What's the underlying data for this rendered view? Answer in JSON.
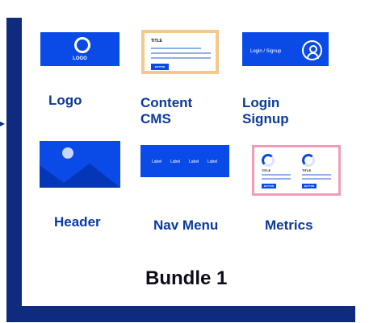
{
  "bundle": {
    "title": "Bundle 1"
  },
  "pointer": {
    "glyph": "▸"
  },
  "modules": {
    "logo": {
      "label": "Logo",
      "thumb_text": "LOGO"
    },
    "cms": {
      "label_line1": "Content",
      "label_line2": "CMS",
      "thumb_title": "TITLE",
      "thumb_button": "BUTTON"
    },
    "login": {
      "label_line1": "Login",
      "label_line2": "Signup",
      "thumb_text": "Login / Signup"
    },
    "header": {
      "label": "Header"
    },
    "nav": {
      "label": "Nav Menu",
      "items": [
        "Label",
        "Label",
        "Label",
        "Label"
      ]
    },
    "metrics": {
      "label": "Metrics",
      "cards": [
        {
          "title": "TITLE",
          "button": "BUTTON"
        },
        {
          "title": "TITLE",
          "button": "BUTTON"
        }
      ]
    }
  },
  "colors": {
    "frame": "#0f2b7f",
    "accent_blue": "#0a4ae6",
    "label_blue": "#0a3aa0",
    "cms_border": "#f4c98a",
    "metrics_border": "#f29bb8"
  }
}
